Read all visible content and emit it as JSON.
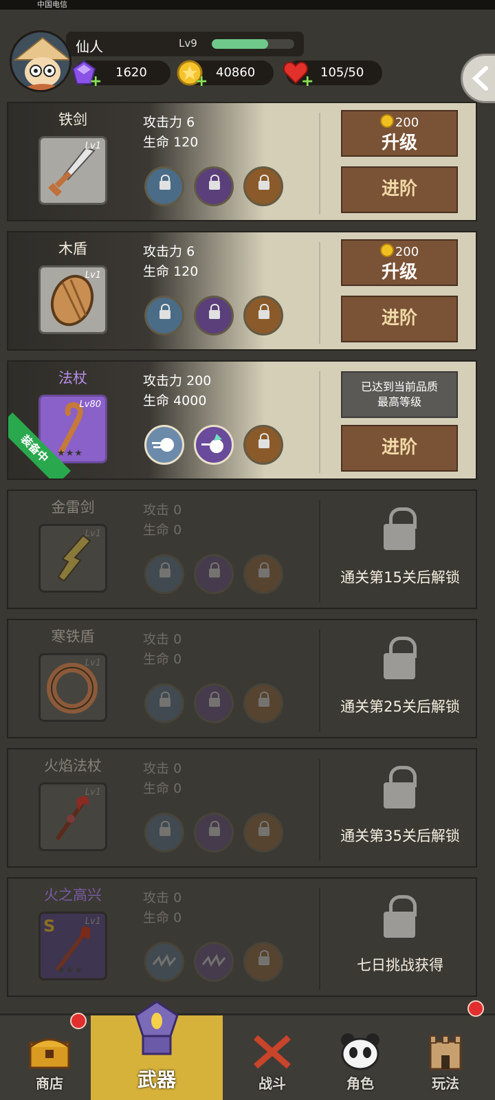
{
  "status_bar": {
    "carrier": "中国电信"
  },
  "player": {
    "name": "仙人",
    "level": "Lv9",
    "xp_fraction": 0.68,
    "gems": "1620",
    "coins": "40860",
    "stamina": "105/50"
  },
  "weapons": [
    {
      "name": "铁剑",
      "level": "Lv1",
      "atk_label": "攻击力",
      "atk": "6",
      "hp_label": "生命",
      "hp": "120",
      "upgrade_cost": "200",
      "upgrade_label": "升级",
      "advance_label": "进阶",
      "icon": "iron-sword-icon"
    },
    {
      "name": "木盾",
      "level": "Lv1",
      "atk_label": "攻击力",
      "atk": "6",
      "hp_label": "生命",
      "hp": "120",
      "upgrade_cost": "200",
      "upgrade_label": "升级",
      "advance_label": "进阶",
      "icon": "wooden-shield-icon"
    },
    {
      "name": "法杖",
      "level": "Lv80",
      "atk_label": "攻击力",
      "atk": "200",
      "hp_label": "生命",
      "hp": "4000",
      "max_text_1": "已达到当前品质",
      "max_text_2": "最高等级",
      "advance_label": "进阶",
      "equipped_label": "装备中",
      "icon": "staff-icon"
    },
    {
      "name": "金雷剑",
      "level": "Lv1",
      "atk_label": "攻击",
      "atk": "0",
      "hp_label": "生命",
      "hp": "0",
      "unlock_text": "通关第15关后解锁",
      "icon": "thunder-sword-icon"
    },
    {
      "name": "寒铁盾",
      "level": "Lv1",
      "atk_label": "攻击",
      "atk": "0",
      "hp_label": "生命",
      "hp": "0",
      "unlock_text": "通关第25关后解锁",
      "icon": "iron-ring-shield-icon"
    },
    {
      "name": "火焰法杖",
      "level": "Lv1",
      "atk_label": "攻击",
      "atk": "0",
      "hp_label": "生命",
      "hp": "0",
      "unlock_text": "通关第35关后解锁",
      "icon": "fire-staff-icon"
    },
    {
      "name": "火之高兴",
      "level": "Lv1",
      "atk_label": "攻击",
      "atk": "0",
      "hp_label": "生命",
      "hp": "0",
      "unlock_text": "七日挑战获得",
      "icon": "fire-sword-icon",
      "grade": "S"
    }
  ],
  "nav": {
    "shop": "商店",
    "weapon": "武器",
    "battle": "战斗",
    "role": "角色",
    "play": "玩法"
  },
  "colors": {
    "accent": "#d6b23b",
    "wood": "#7a5236",
    "card_bg": "#d5cfb8",
    "purple": "#8a60c9"
  }
}
